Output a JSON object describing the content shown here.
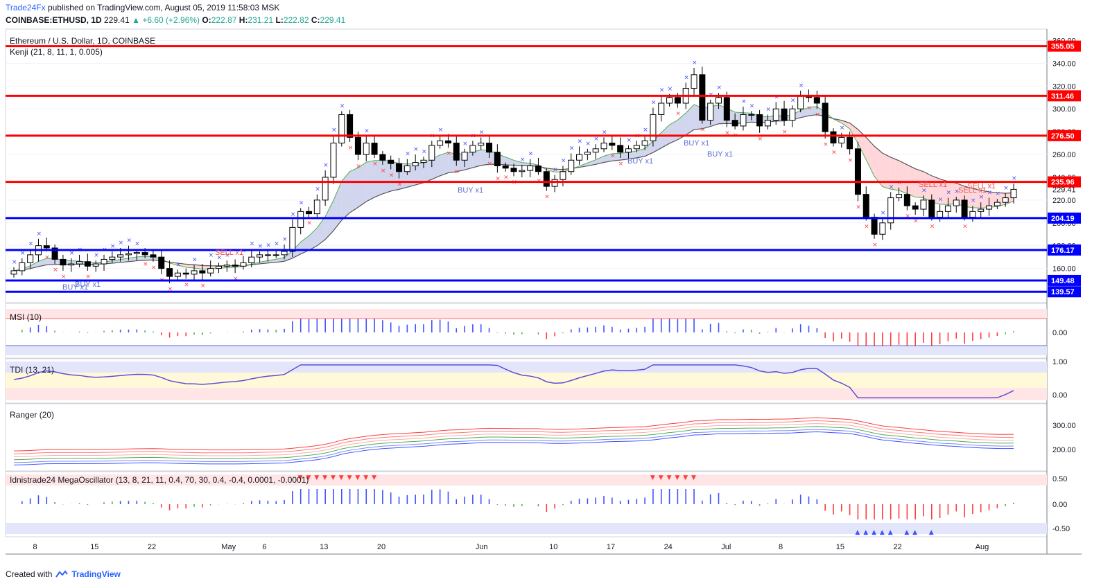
{
  "header": {
    "brand": "Trade24Fx",
    "published": "published on TradingView.com, August 05, 2019 11:58:03 MSK",
    "symbol": "COINBASE:ETHUSD, 1D",
    "last": "229.41",
    "change": "+6.60 (+2.96%)",
    "o_label": "O:",
    "o": "222.87",
    "h_label": "H:",
    "h": "231.21",
    "l_label": "L:",
    "l": "222.82",
    "c_label": "C:",
    "c": "229.41"
  },
  "main_pane": {
    "title": "Ethereum / U.S. Dollar, 1D, COINBASE",
    "indicator": "Kenji (21, 8, 11, 1, 0.005)",
    "price_ticks": [
      "360.00",
      "340.00",
      "320.00",
      "300.00",
      "280.00",
      "260.00",
      "240.00",
      "220.00",
      "200.00",
      "180.00",
      "160.00",
      "140.00"
    ],
    "levels": [
      {
        "value": 355.05,
        "label": "355.05",
        "color": "#ff0000"
      },
      {
        "value": 311.46,
        "label": "311.46",
        "color": "#ff0000"
      },
      {
        "value": 276.5,
        "label": "276.50",
        "color": "#ff0000"
      },
      {
        "value": 235.96,
        "label": "235.96",
        "color": "#ff0000"
      },
      {
        "value": 204.19,
        "label": "204.19",
        "color": "#0000ff"
      },
      {
        "value": 176.17,
        "label": "176.17",
        "color": "#0000ff"
      },
      {
        "value": 149.48,
        "label": "149.48",
        "color": "#0000ff"
      },
      {
        "value": 139.57,
        "label": "139.57",
        "color": "#0000ff"
      }
    ],
    "current_price": "229.41",
    "signals": [
      {
        "text": "BUY x1",
        "type": "buy"
      },
      {
        "text": "BUY x1",
        "type": "buy"
      },
      {
        "text": "SELL x1",
        "type": "sell"
      },
      {
        "text": "BUY x1",
        "type": "buy"
      },
      {
        "text": "BUY x1",
        "type": "buy"
      },
      {
        "text": "BUY x1",
        "type": "buy"
      },
      {
        "text": "BUY x1",
        "type": "buy"
      },
      {
        "text": "SELL x1",
        "type": "sell"
      },
      {
        "text": "SELL x1",
        "type": "sell"
      },
      {
        "text": "SELL x1",
        "type": "sell"
      }
    ]
  },
  "panes": {
    "msi": {
      "title": "MSI (10)",
      "ticks": [
        "0.00"
      ]
    },
    "tdi": {
      "title": "TDI (13, 21)",
      "ticks": [
        "1.00",
        "0.00"
      ]
    },
    "ranger": {
      "title": "Ranger (20)",
      "ticks": [
        "300.00",
        "200.00"
      ]
    },
    "mega": {
      "title": "Idnistrade24 MegaOscillator (13, 8, 21, 11, 0.4, 70, 30, 0.4, -0.4, 0.0001, -0.0001)",
      "ticks": [
        "0.50",
        "0.00",
        "-0.50"
      ]
    }
  },
  "x_axis": [
    "8",
    "15",
    "22",
    "May",
    "6",
    "13",
    "20",
    "Jun",
    "10",
    "17",
    "24",
    "Jul",
    "8",
    "15",
    "22",
    "Aug"
  ],
  "footer": {
    "created_with": "Created with",
    "brand": "TradingView"
  },
  "colors": {
    "bull_candle": "#ffffff",
    "bear_candle": "#000000",
    "resistance": "#ff0000",
    "support": "#0000ff",
    "cloud_bull": "#c5cae9",
    "cloud_bear": "#ffcdd2"
  },
  "chart_data": {
    "type": "candlestick",
    "title": "Ethereum / U.S. Dollar, 1D, COINBASE",
    "ylim": [
      130,
      370
    ],
    "dates": [
      "04-05",
      "04-06",
      "04-07",
      "04-08",
      "04-09",
      "04-10",
      "04-11",
      "04-12",
      "04-13",
      "04-14",
      "04-15",
      "04-16",
      "04-17",
      "04-18",
      "04-19",
      "04-20",
      "04-21",
      "04-22",
      "04-23",
      "04-24",
      "04-25",
      "04-26",
      "04-27",
      "04-28",
      "04-29",
      "04-30",
      "05-01",
      "05-02",
      "05-03",
      "05-04",
      "05-05",
      "05-06",
      "05-07",
      "05-08",
      "05-09",
      "05-10",
      "05-11",
      "05-12",
      "05-13",
      "05-14",
      "05-15",
      "05-16",
      "05-17",
      "05-18",
      "05-19",
      "05-20",
      "05-21",
      "05-22",
      "05-23",
      "05-24",
      "05-25",
      "05-26",
      "05-27",
      "05-28",
      "05-29",
      "05-30",
      "05-31",
      "06-01",
      "06-02",
      "06-03",
      "06-04",
      "06-05",
      "06-06",
      "06-07",
      "06-08",
      "06-09",
      "06-10",
      "06-11",
      "06-12",
      "06-13",
      "06-14",
      "06-15",
      "06-16",
      "06-17",
      "06-18",
      "06-19",
      "06-20",
      "06-21",
      "06-22",
      "06-23",
      "06-24",
      "06-25",
      "06-26",
      "06-27",
      "06-28",
      "06-29",
      "06-30",
      "07-01",
      "07-02",
      "07-03",
      "07-04",
      "07-05",
      "07-06",
      "07-07",
      "07-08",
      "07-09",
      "07-10",
      "07-11",
      "07-12",
      "07-13",
      "07-14",
      "07-15",
      "07-16",
      "07-17",
      "07-18",
      "07-19",
      "07-20",
      "07-21",
      "07-22",
      "07-23",
      "07-24",
      "07-25",
      "07-26",
      "07-27",
      "07-28",
      "07-29",
      "07-30",
      "07-31",
      "08-01",
      "08-02",
      "08-03",
      "08-04",
      "08-05"
    ],
    "close": [
      158,
      165,
      172,
      180,
      178,
      168,
      163,
      164,
      166,
      162,
      164,
      168,
      170,
      172,
      173,
      174,
      172,
      170,
      160,
      153,
      156,
      155,
      158,
      156,
      160,
      162,
      163,
      162,
      165,
      170,
      172,
      172,
      172,
      175,
      196,
      210,
      208,
      220,
      240,
      270,
      295,
      275,
      260,
      270,
      260,
      255,
      252,
      245,
      250,
      253,
      255,
      268,
      272,
      270,
      255,
      262,
      268,
      270,
      262,
      250,
      248,
      245,
      246,
      250,
      245,
      232,
      238,
      245,
      255,
      260,
      262,
      265,
      270,
      268,
      262,
      265,
      268,
      272,
      295,
      305,
      310,
      305,
      318,
      330,
      290,
      305,
      310,
      290,
      285,
      295,
      295,
      285,
      290,
      300,
      290,
      300,
      312,
      310,
      305,
      280,
      270,
      275,
      265,
      225,
      205,
      190,
      200,
      222,
      225,
      215,
      212,
      220,
      205,
      210,
      215,
      220,
      205,
      210,
      212,
      215,
      218,
      222,
      229.41
    ],
    "series": [
      {
        "name": "MSI (10)",
        "ylim": [
          -1.2,
          1.2
        ]
      },
      {
        "name": "TDI (13, 21)",
        "ylim": [
          -0.2,
          1.2
        ]
      },
      {
        "name": "Ranger (20)",
        "ylim": [
          140,
          360
        ]
      },
      {
        "name": "Idnistrade24 MegaOscillator",
        "ylim": [
          -0.7,
          0.7
        ]
      }
    ]
  }
}
